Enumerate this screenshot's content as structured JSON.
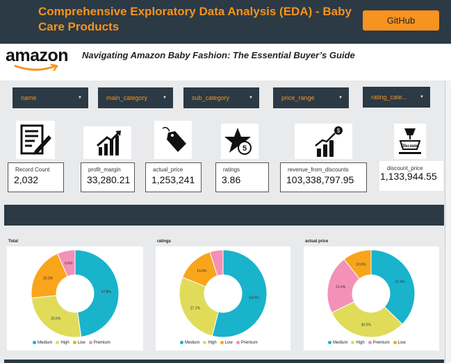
{
  "header": {
    "title": "Comprehensive Exploratory Data Analysis (EDA) - Baby Care Products",
    "github_label": "GitHub"
  },
  "brand": {
    "logo_text": "amazon",
    "subtitle": "Navigating Amazon Baby Fashion: The Essential Buyer’s Guide"
  },
  "filters": [
    {
      "label": "name"
    },
    {
      "label": "main_category"
    },
    {
      "label": "sub_category"
    },
    {
      "label": "price_range"
    },
    {
      "label": "rating_cate..."
    }
  ],
  "icons": [
    "document-icon",
    "profit-chart-icon",
    "price-tag-icon",
    "star-rating-icon",
    "revenue-chart-icon",
    "discount-icon"
  ],
  "discount_icon_text": "Discount",
  "kpis": [
    {
      "label": "Record Count",
      "value": "2,032"
    },
    {
      "label": "profit_margin",
      "value": "33,280.21"
    },
    {
      "label": "actual_price",
      "value": "1,253,241"
    },
    {
      "label": "ratings",
      "value": "3.86"
    },
    {
      "label": "revenue_from_discounts",
      "value": "103,338,797.95"
    },
    {
      "label": "discount_price",
      "value": "1,133,944.55"
    }
  ],
  "colors": {
    "Medium": "#19b3cc",
    "High": "#e0dc5a",
    "Low": "#f8a51c",
    "Premium": "#f391b7",
    "header": "#2b3a44",
    "accent": "#f7931e"
  },
  "chart_data": [
    {
      "type": "pie",
      "title": "Total",
      "legend": [
        "Medium",
        "High",
        "Low",
        "Premium"
      ],
      "slices": [
        {
          "name": "Medium",
          "value": 47.8,
          "label": "47.8%"
        },
        {
          "name": "High",
          "value": 25.6,
          "label": "25.6%"
        },
        {
          "name": "Low",
          "value": 20.0,
          "label": "20.0%"
        },
        {
          "name": "Premium",
          "value": 6.6,
          "label": "6.6%"
        }
      ]
    },
    {
      "type": "pie",
      "title": "ratings",
      "legend": [
        "Medium",
        "High",
        "Low",
        "Premium"
      ],
      "slices": [
        {
          "name": "Medium",
          "value": 54.0,
          "label": "54.0%"
        },
        {
          "name": "High",
          "value": 27.1,
          "label": "27.1%"
        },
        {
          "name": "Low",
          "value": 14.0,
          "label": "14.0%"
        },
        {
          "name": "Premium",
          "value": 4.9,
          "label": ""
        }
      ]
    },
    {
      "type": "pie",
      "title": "actual price",
      "legend": [
        "Medium",
        "High",
        "Premium",
        "Low"
      ],
      "slices": [
        {
          "name": "Medium",
          "value": 37.4,
          "label": "37.4%"
        },
        {
          "name": "High",
          "value": 30.5,
          "label": "30.5%"
        },
        {
          "name": "Premium",
          "value": 21.6,
          "label": "21.6%"
        },
        {
          "name": "Low",
          "value": 10.6,
          "label": "10.6%"
        }
      ]
    }
  ]
}
